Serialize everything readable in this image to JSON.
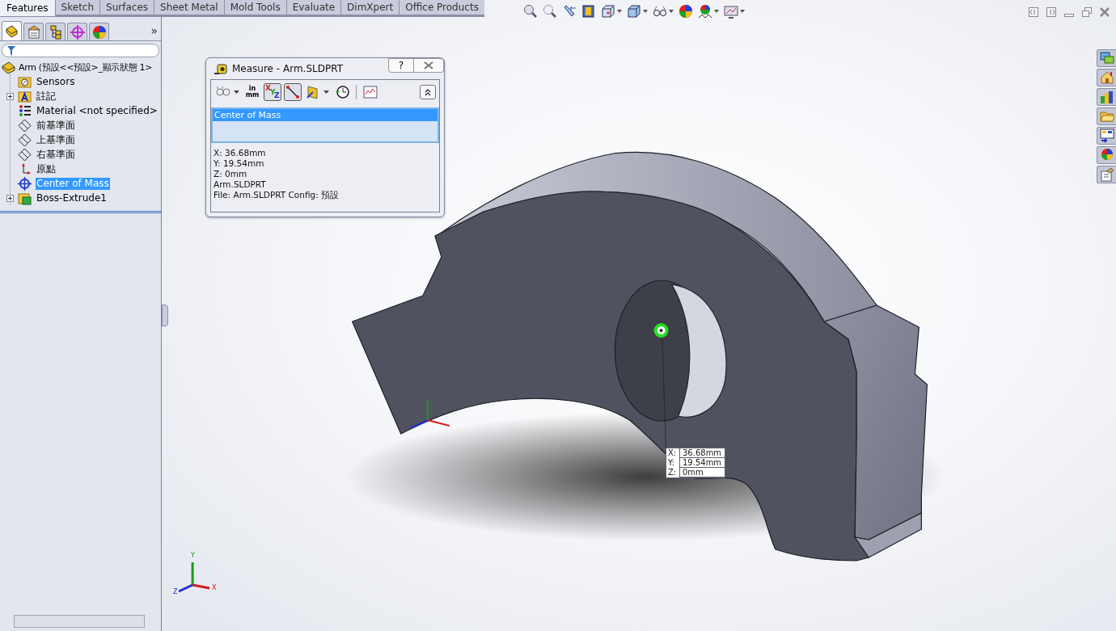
{
  "command_tabs": [
    {
      "label": "Features",
      "selected": true
    },
    {
      "label": "Sketch",
      "selected": false
    },
    {
      "label": "Surfaces",
      "selected": false
    },
    {
      "label": "Sheet Metal",
      "selected": false
    },
    {
      "label": "Mold Tools",
      "selected": false
    },
    {
      "label": "Evaluate",
      "selected": false
    },
    {
      "label": "DimXpert",
      "selected": false
    },
    {
      "label": "Office Products",
      "selected": false
    }
  ],
  "panel_tabs": [
    {
      "kind": "feature",
      "selected": true
    },
    {
      "kind": "property",
      "selected": false
    },
    {
      "kind": "config",
      "selected": false
    },
    {
      "kind": "dimxpert",
      "selected": false
    },
    {
      "kind": "display",
      "selected": false
    }
  ],
  "panel_more": "»",
  "tree": {
    "label": "Arm (預設<<預設>_顯示狀態 1>",
    "children": [
      {
        "label": "Sensors",
        "kind": "sensors",
        "expandable": false,
        "selected": false
      },
      {
        "label": "註記",
        "kind": "annotations",
        "expandable": true,
        "selected": false
      },
      {
        "label": "Material <not specified>",
        "kind": "material",
        "expandable": false,
        "selected": false
      },
      {
        "label": "前基準面",
        "kind": "plane",
        "expandable": false,
        "selected": false
      },
      {
        "label": "上基準面",
        "kind": "plane",
        "expandable": false,
        "selected": false
      },
      {
        "label": "右基準面",
        "kind": "plane",
        "expandable": false,
        "selected": false
      },
      {
        "label": "原點",
        "kind": "origin",
        "expandable": false,
        "selected": false
      },
      {
        "label": "Center of Mass",
        "kind": "com",
        "expandable": false,
        "selected": true
      },
      {
        "label": "Boss-Extrude1",
        "kind": "feature",
        "expandable": true,
        "selected": false
      }
    ]
  },
  "heads_up_toolbar": [
    {
      "kind": "zoom-fit",
      "dropdown": false
    },
    {
      "kind": "zoom-area",
      "dropdown": false
    },
    {
      "kind": "previous",
      "dropdown": false
    },
    {
      "kind": "section",
      "dropdown": false
    },
    {
      "kind": "orientation",
      "dropdown": true
    },
    {
      "kind": "display-style",
      "dropdown": true
    },
    {
      "kind": "hide-show",
      "dropdown": true
    },
    {
      "kind": "appearance",
      "dropdown": false
    },
    {
      "kind": "scene",
      "dropdown": true
    },
    {
      "kind": "view-settings",
      "dropdown": true
    }
  ],
  "task_pane": [
    {
      "kind": "resources"
    },
    {
      "kind": "home"
    },
    {
      "kind": "library"
    },
    {
      "kind": "folder"
    },
    {
      "kind": "palette"
    },
    {
      "kind": "appearance"
    },
    {
      "kind": "custom"
    }
  ],
  "measure": {
    "title": "Measure - Arm.SLDPRT",
    "help": "?",
    "toolbar": [
      {
        "kind": "arc",
        "pressed": false,
        "dropdown": true
      },
      {
        "kind": "units",
        "lines": [
          "in",
          "mm"
        ],
        "pressed": false,
        "dropdown": false
      },
      {
        "kind": "xyz",
        "letters": [
          "X",
          "Y",
          "Z"
        ],
        "pressed": true,
        "dropdown": false
      },
      {
        "kind": "distance",
        "pressed": true,
        "dropdown": false
      },
      {
        "kind": "projection",
        "pressed": false,
        "dropdown": true
      },
      {
        "kind": "history",
        "pressed": false,
        "dropdown": false
      },
      {
        "kind": "sensor",
        "pressed": false,
        "dropdown": false
      }
    ],
    "selections": [
      {
        "label": "Center of Mass",
        "selected": true
      }
    ],
    "results": [
      "X: 36.68mm",
      "Y: 19.54mm",
      "Z: 0mm",
      "Arm.SLDPRT",
      "File: Arm.SLDPRT Config: 預設"
    ]
  },
  "callout": [
    {
      "axis": "X:",
      "value": "36.68mm"
    },
    {
      "axis": "Y:",
      "value": "19.54mm"
    },
    {
      "axis": "Z:",
      "value": "0mm"
    }
  ],
  "triad": {
    "x": "X",
    "y": "Y",
    "z": "Z"
  }
}
